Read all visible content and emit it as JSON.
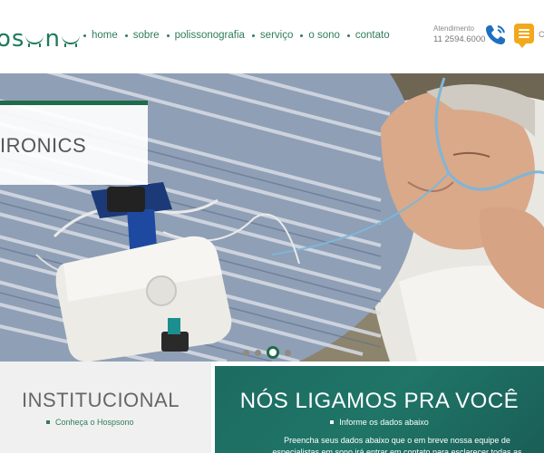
{
  "header": {
    "logo": "hospsono",
    "logo_visible": "osno",
    "nav": [
      {
        "label": "home"
      },
      {
        "label": "sobre"
      },
      {
        "label": "polissonografia"
      },
      {
        "label": "serviço"
      },
      {
        "label": "o sono"
      },
      {
        "label": "contato"
      }
    ],
    "contact_label": "Atendimento",
    "contact_phone": "11 2594.6000",
    "phone_icon": "phone-icon",
    "chat_icon": "chat-icon",
    "extra_text": "C"
  },
  "hero": {
    "caption": "IRONICS",
    "slide_dots": 4,
    "active_slide": 3
  },
  "institucional": {
    "title": "INSTITUCIONAL",
    "link": "Conheça o Hospsono"
  },
  "callback": {
    "title": "NÓS LIGAMOS PRA VOCÊ",
    "subtitle": "Informe os dados abaixo",
    "text": "Preencha seus dados abaixo que o em breve nossa equipe de especialistas em sono irá entrar em contato para esclarecer todas as"
  },
  "colors": {
    "brand_green": "#1f6b4a",
    "nav_green": "#2f7d5a",
    "teal_panel": "#1d6b62",
    "chat_orange": "#f2a81c",
    "phone_blue": "#1e6fc1"
  }
}
